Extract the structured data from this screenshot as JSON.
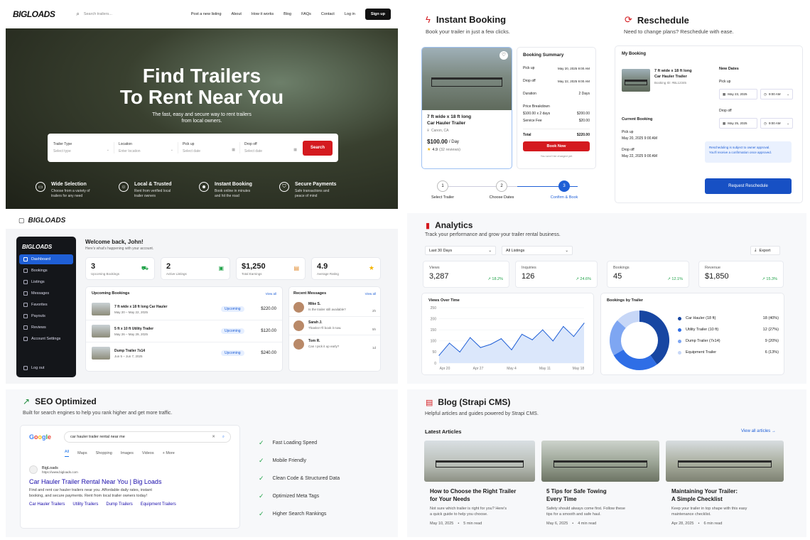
{
  "hero": {
    "logo": "BIGLOADS",
    "search_placeholder": "Search trailers...",
    "nav": [
      "Post a new listing",
      "About",
      "How it works",
      "Blog",
      "FAQs",
      "Contact",
      "Log in"
    ],
    "signup": "Sign up",
    "title_line1": "Find Trailers",
    "title_line2": "To Rent Near You",
    "subtitle_line1": "The fast, easy and secure way to rent trailers",
    "subtitle_line2": "from local owners.",
    "search": {
      "trailer_type_label": "Trailer Type",
      "trailer_type_ph": "Select type",
      "location_label": "Location",
      "location_ph": "Enter location",
      "pickup_label": "Pick up",
      "pickup_ph": "Select date",
      "dropoff_label": "Drop off",
      "dropoff_ph": "Select date",
      "button": "Search"
    },
    "features": [
      {
        "title": "Wide Selection",
        "l1": "Choose from a variety of",
        "l2": "trailers for any need"
      },
      {
        "title": "Local & Trusted",
        "l1": "Rent from verified local",
        "l2": "trailer owners"
      },
      {
        "title": "Instant Booking",
        "l1": "Book online in minutes",
        "l2": "and hit the road"
      },
      {
        "title": "Secure Payments",
        "l1": "Safe transactions and",
        "l2": "peace of mind"
      }
    ]
  },
  "instant": {
    "title": "Instant Booking",
    "subtitle": "Book your trailer in just a few clicks.",
    "listing": {
      "name_l1": "7 ft wide x 18 ft long",
      "name_l2": "Car Hauler Trailer",
      "location": "Canon, CA",
      "price": "$100.00",
      "per": "/ Day",
      "rating": "4.9",
      "reviews": "(32 reviews)"
    },
    "summary": {
      "title": "Booking Summary",
      "pickup_label": "Pick up",
      "pickup_val": "May 20, 2025  9:00 AM",
      "dropoff_label": "Drop off",
      "dropoff_val": "May 22, 2025  9:00 AM",
      "duration_label": "Duration",
      "duration_val": "2 Days",
      "breakdown_label": "Price Breakdown",
      "line1_label": "$100.00 x 2 days",
      "line1_val": "$200.00",
      "fee_label": "Service Fee",
      "fee_val": "$20.00",
      "total_label": "Total",
      "total_val": "$220.00",
      "button": "Book Now",
      "note": "You won't be charged yet"
    },
    "steps": [
      {
        "n": "1",
        "label": "Select Trailer"
      },
      {
        "n": "2",
        "label": "Choose Dates"
      },
      {
        "n": "3",
        "label": "Confirm & Book"
      }
    ]
  },
  "reschedule": {
    "title": "Reschedule",
    "subtitle": "Need to change plans? Reschedule with ease.",
    "my_booking": "My Booking",
    "item_l1": "7 ft wide x 18 ft long",
    "item_l2": "Car Hauler Trailer",
    "booking_id": "Booking ID: #BL12345",
    "new_dates": "New Dates",
    "pickup": "Pick up",
    "pickup_date": "May 23, 2025",
    "pickup_time": "9:00 AM",
    "dropoff": "Drop off",
    "dropoff_date": "May 25, 2025",
    "dropoff_time": "9:00 AM",
    "current": "Current Booking",
    "cur_pickup_label": "Pick up",
    "cur_pickup": "May 20, 2025   9:00 AM",
    "cur_dropoff_label": "Drop off",
    "cur_dropoff": "May 22, 2025   9:00 AM",
    "notice_l1": "Rescheduling is subject to owner approval.",
    "notice_l2": "You'll receive a confirmation once approved.",
    "button": "Request Reschedule"
  },
  "dashboard": {
    "logo": "BIGLOADS",
    "sidebar": [
      "Dashboard",
      "Bookings",
      "Listings",
      "Messages",
      "Favorites",
      "Payouts",
      "Reviews",
      "Account Settings"
    ],
    "logout": "Log out",
    "welcome": "Welcome back, John!",
    "welcome_sub": "Here's what's happening with your account.",
    "stats": [
      {
        "v": "3",
        "l": "Upcoming Bookings"
      },
      {
        "v": "2",
        "l": "Active Listings"
      },
      {
        "v": "$1,250",
        "l": "Total Earnings"
      },
      {
        "v": "4.9",
        "l": "Average Rating"
      }
    ],
    "upcoming_title": "Upcoming Bookings",
    "view_all": "View all",
    "bookings": [
      {
        "name": "7 ft wide x 18 ft long Car Hauler",
        "dates": "May 20 – May 22, 2025",
        "status": "Upcoming",
        "price": "$220.00"
      },
      {
        "name": "5 ft x 10 ft Utility Trailer",
        "dates": "May 26 – May 29, 2025",
        "status": "Upcoming",
        "price": "$120.00"
      },
      {
        "name": "Dump Trailer 7x14",
        "dates": "Jun 5 – Jun 7, 2025",
        "status": "Upcoming",
        "price": "$240.00"
      }
    ],
    "messages_title": "Recent Messages",
    "messages": [
      {
        "name": "Mike S.",
        "text": "Is the trailer still available?",
        "time": "2h"
      },
      {
        "name": "Sarah J.",
        "text": "Thanks! I'll book it now.",
        "time": "5h"
      },
      {
        "name": "Tom R.",
        "text": "Can I pick it up early?",
        "time": "1d"
      }
    ]
  },
  "analytics": {
    "title": "Analytics",
    "subtitle": "Track your performance and grow your trailer rental business.",
    "range": "Last 30 Days",
    "listings": "All Listings",
    "export": "Export",
    "kpis": [
      {
        "l": "Views",
        "v": "3,287",
        "d": "18.2%"
      },
      {
        "l": "Inquiries",
        "v": "126",
        "d": "24.6%"
      },
      {
        "l": "Bookings",
        "v": "45",
        "d": "12.1%"
      },
      {
        "l": "Revenue",
        "v": "$1,850",
        "d": "15.3%"
      }
    ],
    "views_title": "Views Over Time",
    "by_trailer_title": "Bookings by Trailer",
    "legend": [
      {
        "name": "Car Hauler (18 ft)",
        "val": "18 (40%)",
        "color": "#1746a2"
      },
      {
        "name": "Utility Trailer (10 ft)",
        "val": "12 (27%)",
        "color": "#2f6ee6"
      },
      {
        "name": "Dump Trailer (7x14)",
        "val": "9 (20%)",
        "color": "#7ea6f2"
      },
      {
        "name": "Equipment Trailer",
        "val": "6 (13%)",
        "color": "#c7d7f7"
      }
    ]
  },
  "chart_data": [
    {
      "type": "area",
      "title": "Views Over Time",
      "x": [
        "Apr 20",
        "Apr 23",
        "Apr 25",
        "Apr 27",
        "Apr 29",
        "May 1",
        "May 3",
        "May 5",
        "May 7",
        "May 9",
        "May 11",
        "May 13",
        "May 15",
        "May 17",
        "May 18"
      ],
      "values": [
        35,
        90,
        50,
        115,
        70,
        85,
        110,
        60,
        130,
        105,
        150,
        100,
        165,
        120,
        180
      ],
      "xticks": [
        "Apr 20",
        "Apr 27",
        "May 4",
        "May 11",
        "May 18"
      ],
      "yticks": [
        0,
        50,
        100,
        150,
        200,
        250
      ],
      "ylim": [
        0,
        250
      ]
    },
    {
      "type": "pie",
      "title": "Bookings by Trailer",
      "categories": [
        "Car Hauler (18 ft)",
        "Utility Trailer (10 ft)",
        "Dump Trailer (7x14)",
        "Equipment Trailer"
      ],
      "values": [
        18,
        12,
        9,
        6
      ]
    }
  ],
  "seo": {
    "title": "SEO Optimized",
    "subtitle": "Built for search engines to help you rank higher and get more traffic.",
    "query": "car hauler trailer rental near me",
    "tabs": [
      "All",
      "Maps",
      "Shopping",
      "Images",
      "Videos",
      "+ More"
    ],
    "site_name": "BigLoads",
    "site_url": "https://www.bigloads.com",
    "result_title": "Car Hauler Trailer Rental Near You | Big Loads",
    "desc_l1": "Find and rent car hauler trailers near you. Affordable daily rates, instant",
    "desc_l2": "booking, and secure payments. Rent from local trailer owners today!",
    "links": [
      "Car Hauler Trailers",
      "Utility Trailers",
      "Dump Trailers",
      "Equipment Trailers"
    ],
    "features": [
      "Fast Loading Speed",
      "Mobile Friendly",
      "Clean Code & Structured Data",
      "Optimized Meta Tags",
      "Higher Search Rankings"
    ]
  },
  "blog": {
    "title": "Blog (Strapi CMS)",
    "subtitle": "Helpful articles and guides powered by Strapi CMS.",
    "latest": "Latest Articles",
    "view_all": "View all articles →",
    "articles": [
      {
        "t1": "How to Choose the Right Trailer",
        "t2": "for Your Needs",
        "e1": "Not sure which trailer is right for you? Here's",
        "e2": "a quick guide to help you choose.",
        "date": "May 10, 2025",
        "read": "5 min read"
      },
      {
        "t1": "5 Tips for Safe Towing",
        "t2": "Every Time",
        "e1": "Safety should always come first. Follow these",
        "e2": "tips for a smooth and safe haul.",
        "date": "May 6, 2025",
        "read": "4 min read"
      },
      {
        "t1": "Maintaining Your Trailer:",
        "t2": "A Simple Checklist",
        "e1": "Keep your trailer in top shape with this easy",
        "e2": "maintenance checklist.",
        "date": "Apr 28, 2025",
        "read": "6 min read"
      }
    ]
  }
}
